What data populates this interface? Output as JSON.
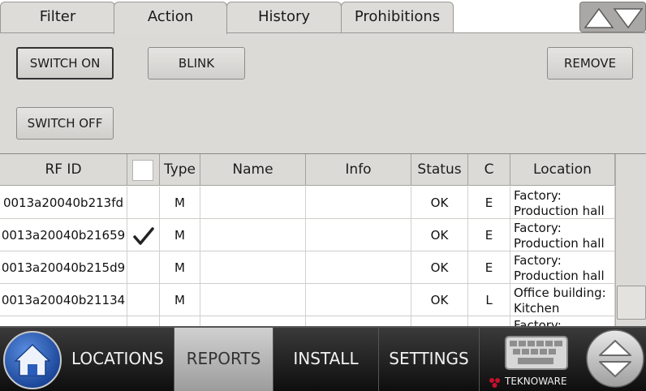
{
  "tabs": [
    {
      "label": "Filter"
    },
    {
      "label": "Action"
    },
    {
      "label": "History"
    },
    {
      "label": "Prohibitions"
    }
  ],
  "action": {
    "switch_on": "SWITCH ON",
    "blink": "BLINK",
    "remove": "REMOVE",
    "switch_off": "SWITCH OFF"
  },
  "table": {
    "headers": {
      "rfid": "RF ID",
      "type": "Type",
      "name": "Name",
      "info": "Info",
      "status": "Status",
      "c": "C",
      "location": "Location"
    },
    "rows": [
      {
        "rfid": "0013a20040b213fd",
        "checked": false,
        "type": "M",
        "name": "",
        "info": "",
        "status": "OK",
        "c": "E",
        "loc1": "Factory:",
        "loc2": "Production hall"
      },
      {
        "rfid": "0013a20040b21659",
        "checked": true,
        "type": "M",
        "name": "",
        "info": "",
        "status": "OK",
        "c": "E",
        "loc1": "Factory:",
        "loc2": "Production hall"
      },
      {
        "rfid": "0013a20040b215d9",
        "checked": false,
        "type": "M",
        "name": "",
        "info": "",
        "status": "OK",
        "c": "E",
        "loc1": "Factory:",
        "loc2": "Production hall"
      },
      {
        "rfid": "0013a20040b21134",
        "checked": false,
        "type": "M",
        "name": "",
        "info": "",
        "status": "OK",
        "c": "L",
        "loc1": "Office building:",
        "loc2": "Kitchen"
      },
      {
        "rfid": "",
        "checked": false,
        "type": "",
        "name": "",
        "info": "",
        "status": "",
        "c": "",
        "loc1": "Factory:",
        "loc2": ""
      }
    ]
  },
  "nav": {
    "locations": "LOCATIONS",
    "reports": "REPORTS",
    "install": "INSTALL",
    "settings": "SETTINGS",
    "brand": "TEKNOWARE"
  },
  "colors": {
    "panel": "#dcdad7",
    "nav_dark": "#1a1a1a",
    "home_blue": "#1d4fa8",
    "brand_red": "#c8102e"
  },
  "icons": [
    "home-icon",
    "keyboard-icon",
    "up-down-arrows-icon",
    "check-icon"
  ]
}
